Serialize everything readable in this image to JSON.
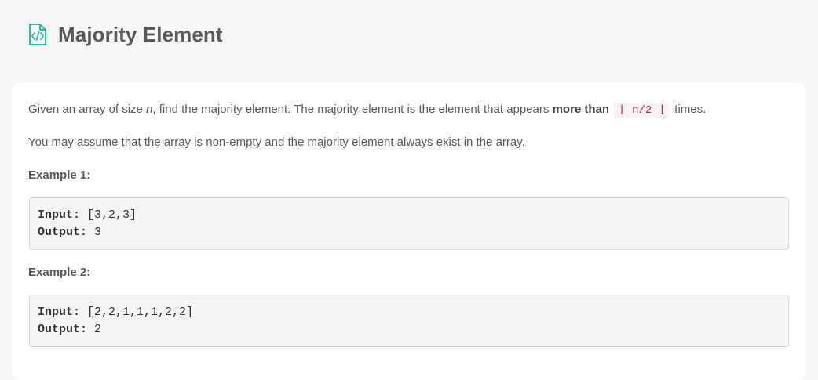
{
  "header": {
    "title": "Majority Element",
    "icon": "code-file-icon",
    "accent_color": "#2db7a4"
  },
  "description": {
    "p1_a": "Given an array of size ",
    "p1_n": "n",
    "p1_b": ", find the majority element. The majority element is the element that appears ",
    "p1_bold": "more than",
    "p1_code": "⌊ n/2 ⌋",
    "p1_c": " times.",
    "p2": "You may assume that the array is non-empty and the majority element always exist in the array."
  },
  "examples": [
    {
      "label": "Example 1:",
      "input_key": "Input:",
      "input_value": " [3,2,3]",
      "output_key": "Output:",
      "output_value": " 3"
    },
    {
      "label": "Example 2:",
      "input_key": "Input:",
      "input_value": " [2,2,1,1,1,2,2]",
      "output_key": "Output:",
      "output_value": " 2"
    }
  ]
}
